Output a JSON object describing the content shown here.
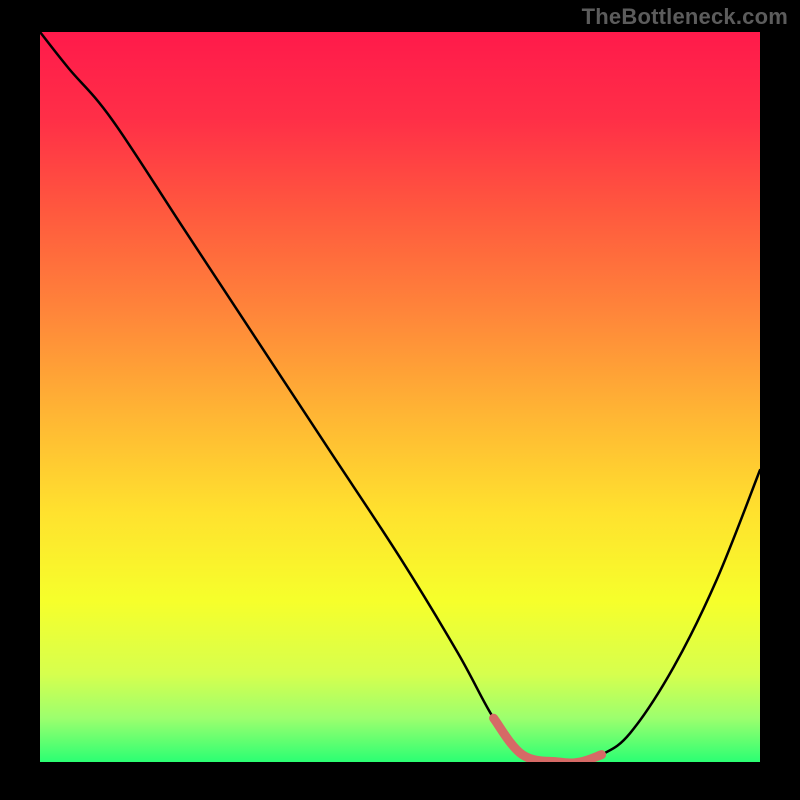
{
  "attribution": "TheBottleneck.com",
  "colors": {
    "bg": "#000000",
    "attribution_text": "#5c5c5c",
    "gradient_stops": [
      {
        "offset": 0.0,
        "color": "#ff1a4b"
      },
      {
        "offset": 0.12,
        "color": "#ff2f47"
      },
      {
        "offset": 0.25,
        "color": "#ff5a3e"
      },
      {
        "offset": 0.38,
        "color": "#ff843a"
      },
      {
        "offset": 0.52,
        "color": "#ffb434"
      },
      {
        "offset": 0.66,
        "color": "#ffe22e"
      },
      {
        "offset": 0.78,
        "color": "#f6ff2b"
      },
      {
        "offset": 0.88,
        "color": "#d6ff4e"
      },
      {
        "offset": 0.94,
        "color": "#9cff6e"
      },
      {
        "offset": 1.0,
        "color": "#2bff73"
      }
    ],
    "curve": "#000000",
    "accent_segment": "#d66a66"
  },
  "chart_data": {
    "type": "line",
    "title": "",
    "xlabel": "",
    "ylabel": "",
    "xlim": [
      0,
      100
    ],
    "ylim": [
      0,
      100
    ],
    "series": [
      {
        "name": "bottleneck-curve",
        "x": [
          0,
          4,
          10,
          20,
          30,
          40,
          50,
          58,
          63,
          67,
          72,
          75,
          78,
          82,
          88,
          94,
          100
        ],
        "y": [
          100,
          95,
          88,
          73,
          58,
          43,
          28,
          15,
          6,
          1,
          0,
          0,
          1,
          4,
          13,
          25,
          40
        ]
      },
      {
        "name": "accent-segment",
        "x": [
          63,
          67,
          72,
          75,
          78
        ],
        "y": [
          6,
          1,
          0,
          0,
          1
        ]
      }
    ],
    "notes": "y-axis inverted visually (0 at bottom); values estimated from pixel positions against the gradient square."
  }
}
